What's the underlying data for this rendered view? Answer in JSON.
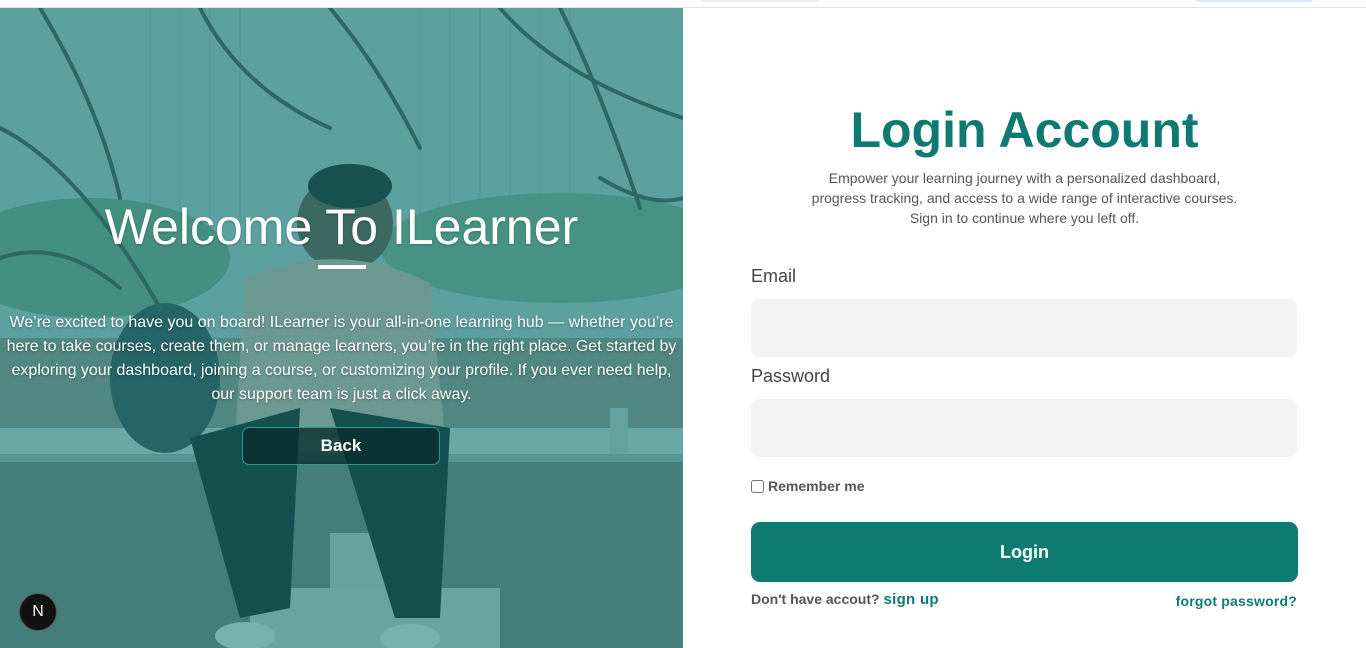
{
  "hero": {
    "title": "Welcome To ILearner",
    "description": "We’re excited to have you on board! ILearner is your all-in-one learning hub — whether you’re here to take courses, create them, or manage learners, you’re in the right place. Get started by exploring your dashboard, joining a course, or customizing your profile. If you ever need help, our support team is just a click away.",
    "back_label": "Back",
    "badge_letter": "N"
  },
  "login": {
    "title": "Login Account",
    "subtitle_lines": [
      "Empower your learning journey with a personalized dashboard,",
      "progress tracking, and access to a wide range of interactive courses.",
      "Sign in to continue where you left off."
    ],
    "email_label": "Email",
    "email_value": "",
    "password_label": "Password",
    "password_value": "",
    "remember_label": "Remember me",
    "remember_checked": false,
    "login_label": "Login",
    "no_account_text": "Don't have accout?",
    "signup_label": "sign up",
    "forgot_label": "forgot password?"
  },
  "colors": {
    "brand": "#0d7b72",
    "input_bg": "#f3f3f3"
  }
}
